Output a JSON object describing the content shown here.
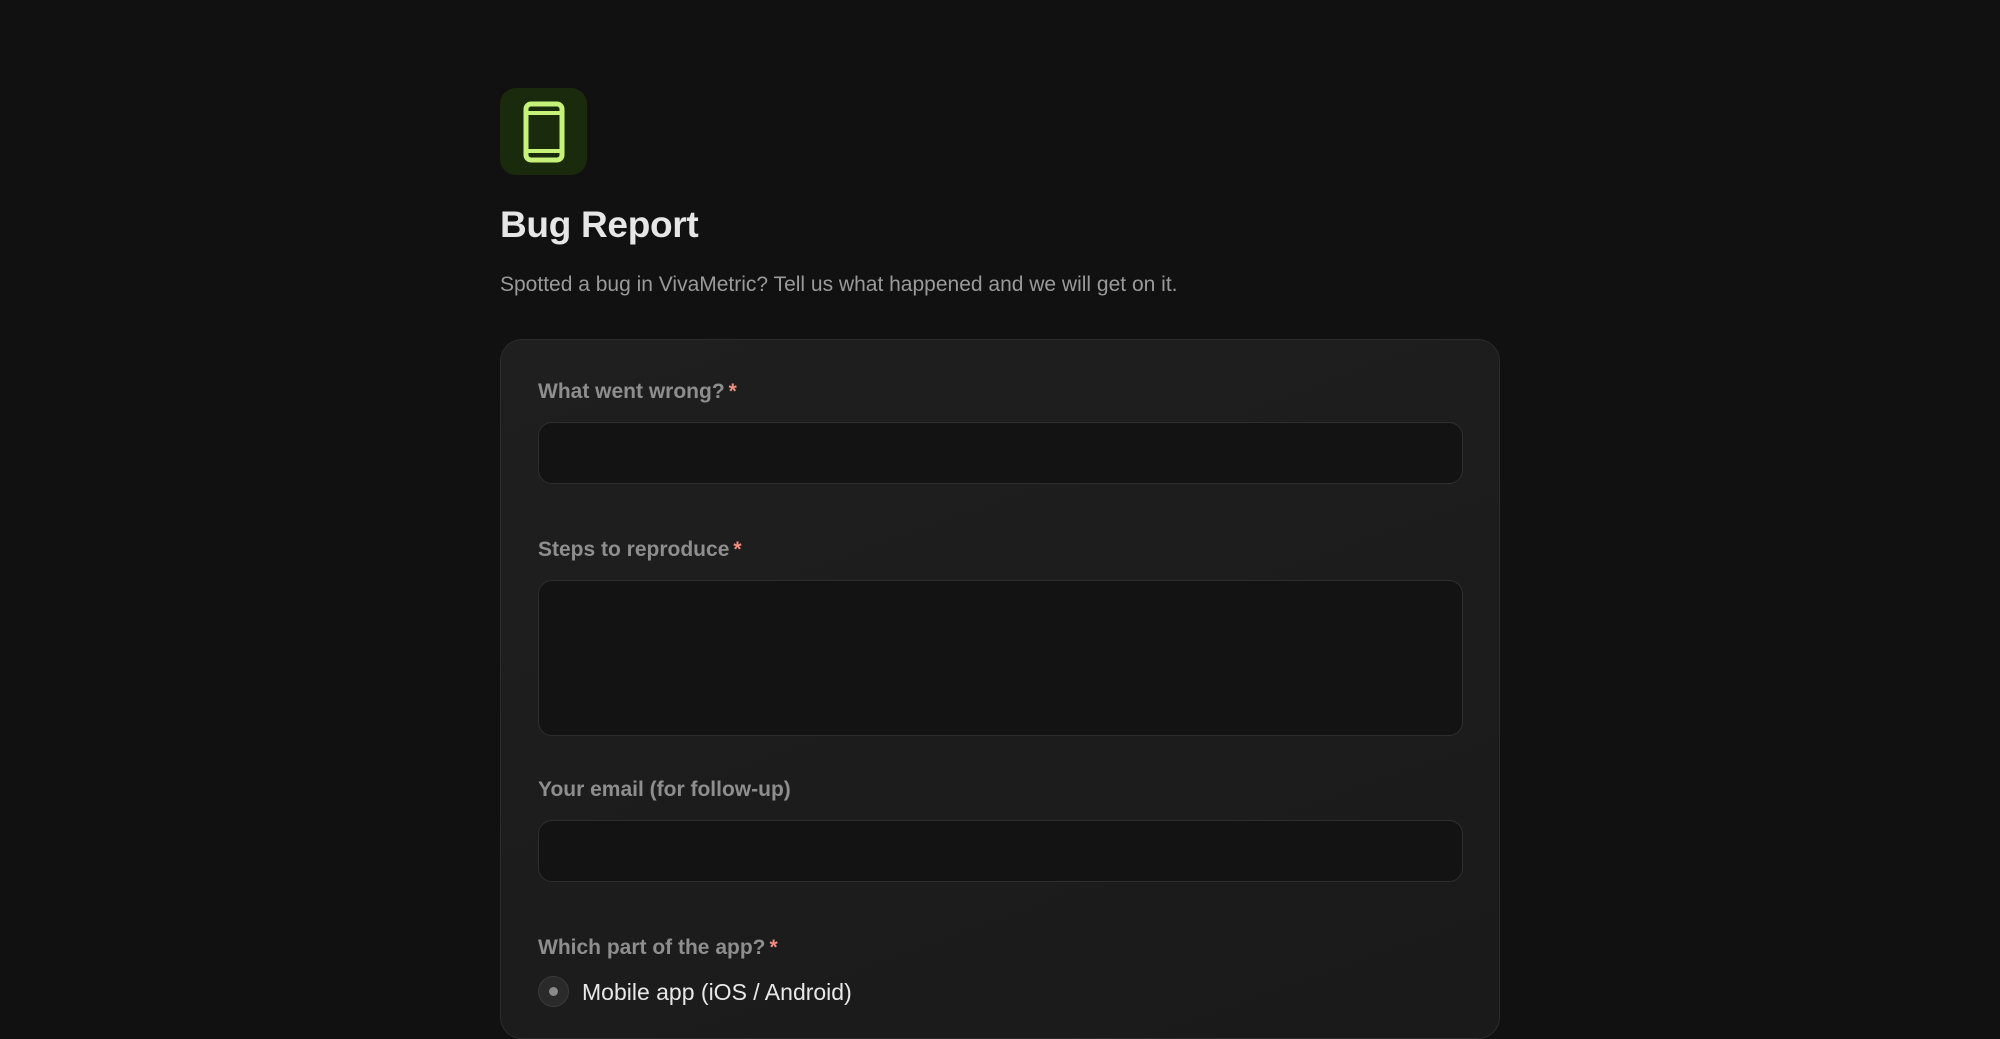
{
  "header": {
    "icon": "mobile-phone-icon",
    "accent_color": "#c6f27a",
    "title": "Bug Report",
    "subtitle": "Spotted a bug in VivaMetric? Tell us what happened and we will get on it."
  },
  "form": {
    "fields": [
      {
        "label": "What went wrong?",
        "required_mark": "*",
        "value": ""
      },
      {
        "label": "Steps to reproduce",
        "required_mark": "*",
        "value": ""
      },
      {
        "label": "Your email (for follow-up)",
        "value": ""
      },
      {
        "label": "Which part of the app?",
        "required_mark": "*",
        "options": [
          {
            "label": "Mobile app (iOS / Android)"
          }
        ]
      }
    ]
  }
}
